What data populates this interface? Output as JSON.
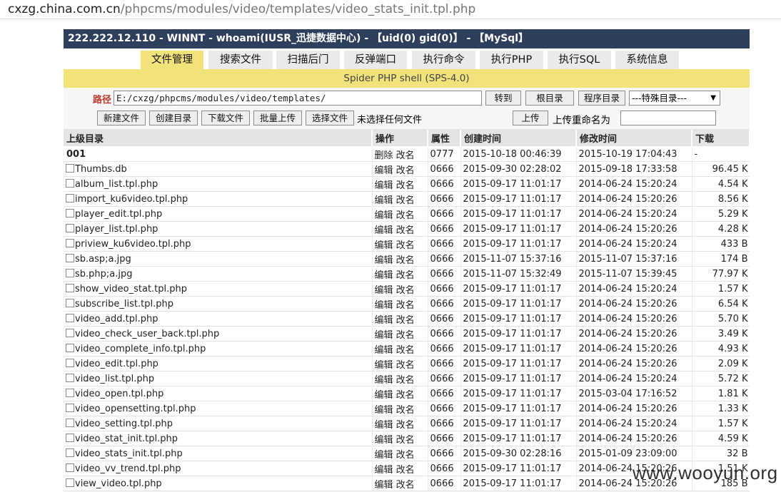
{
  "browser": {
    "url_host": "cxzg.china.com.cn",
    "url_path": "/phpcms/modules/video/templates/video_stats_init.tpl.php"
  },
  "hostbar": {
    "text": "222.222.12.110 - WINNT - whoami(IUSR_迅捷数据中心) - 【uid(0) gid(0)】 - 【MySql】"
  },
  "tabs": [
    {
      "label": "文件管理",
      "active": true
    },
    {
      "label": "搜索文件"
    },
    {
      "label": "扫描后门"
    },
    {
      "label": "反弹端口"
    },
    {
      "label": "执行命令"
    },
    {
      "label": "执行PHP"
    },
    {
      "label": "执行SQL"
    },
    {
      "label": "系统信息"
    }
  ],
  "title": "Spider PHP shell (SPS-4.0)",
  "pathbar": {
    "label": "路径",
    "value": "E:/cxzg/phpcms/modules/video/templates/",
    "goto": "转到",
    "root": "根目录",
    "progdir": "程序目录",
    "special_select": "---特殊目录---"
  },
  "toolbar": {
    "new_file": "新建文件",
    "create_dir": "创建目录",
    "download": "下载文件",
    "batch_upload": "批量上传",
    "choose_file": "选择文件",
    "no_file": "未选择任何文件",
    "upload": "上传",
    "rename_label": "上传重命名为",
    "rename_value": ""
  },
  "table": {
    "headers": [
      "上级目录",
      "操作",
      "属性",
      "创建时间",
      "修改时间",
      "下载"
    ],
    "dir": {
      "name": "001",
      "delete": "删除",
      "rename": "改名",
      "attr": "0777",
      "created": "2015-10-18 00:46:39",
      "modified": "2015-10-19 17:04:43",
      "size": "-"
    },
    "edit_label": "编辑",
    "rename_label": "改名",
    "files": [
      {
        "name": "Thumbs.db",
        "attr": "0666",
        "created": "2015-09-30 02:28:02",
        "modified": "2015-09-18 17:33:58",
        "size": "96.45 K"
      },
      {
        "name": "album_list.tpl.php",
        "attr": "0666",
        "created": "2015-09-17 11:01:17",
        "modified": "2014-06-24 15:20:24",
        "size": "4.54 K"
      },
      {
        "name": "import_ku6video.tpl.php",
        "attr": "0666",
        "created": "2015-09-17 11:01:17",
        "modified": "2014-06-24 15:20:26",
        "size": "8.56 K"
      },
      {
        "name": "player_edit.tpl.php",
        "attr": "0666",
        "created": "2015-09-17 11:01:17",
        "modified": "2014-06-24 15:20:24",
        "size": "5.29 K"
      },
      {
        "name": "player_list.tpl.php",
        "attr": "0666",
        "created": "2015-09-17 11:01:17",
        "modified": "2014-06-24 15:20:26",
        "size": "4.28 K"
      },
      {
        "name": "priview_ku6video.tpl.php",
        "attr": "0666",
        "created": "2015-09-17 11:01:17",
        "modified": "2014-06-24 15:20:24",
        "size": "433 B"
      },
      {
        "name": "sb.asp;a.jpg",
        "attr": "0666",
        "created": "2015-11-07 15:37:16",
        "modified": "2015-11-07 15:37:16",
        "size": "174 B"
      },
      {
        "name": "sb.php;a.jpg",
        "attr": "0666",
        "created": "2015-11-07 15:32:49",
        "modified": "2015-11-07 15:39:45",
        "size": "77.97 K"
      },
      {
        "name": "show_video_stat.tpl.php",
        "attr": "0666",
        "created": "2015-09-17 11:01:17",
        "modified": "2014-06-24 15:20:24",
        "size": "1.57 K"
      },
      {
        "name": "subscribe_list.tpl.php",
        "attr": "0666",
        "created": "2015-09-17 11:01:17",
        "modified": "2014-06-24 15:20:26",
        "size": "6.54 K"
      },
      {
        "name": "video_add.tpl.php",
        "attr": "0666",
        "created": "2015-09-17 11:01:17",
        "modified": "2014-06-24 15:20:26",
        "size": "5.70 K"
      },
      {
        "name": "video_check_user_back.tpl.php",
        "attr": "0666",
        "created": "2015-09-17 11:01:17",
        "modified": "2014-06-24 15:20:26",
        "size": "3.49 K"
      },
      {
        "name": "video_complete_info.tpl.php",
        "attr": "0666",
        "created": "2015-09-17 11:01:17",
        "modified": "2014-06-24 15:20:26",
        "size": "4.93 K"
      },
      {
        "name": "video_edit.tpl.php",
        "attr": "0666",
        "created": "2015-09-17 11:01:17",
        "modified": "2014-06-24 15:20:26",
        "size": "2.09 K"
      },
      {
        "name": "video_list.tpl.php",
        "attr": "0666",
        "created": "2015-09-17 11:01:17",
        "modified": "2014-06-24 15:20:24",
        "size": "5.72 K"
      },
      {
        "name": "video_open.tpl.php",
        "attr": "0666",
        "created": "2015-09-17 11:01:17",
        "modified": "2015-03-04 17:16:52",
        "size": "1.81 K"
      },
      {
        "name": "video_opensetting.tpl.php",
        "attr": "0666",
        "created": "2015-09-17 11:01:17",
        "modified": "2014-06-24 15:20:26",
        "size": "1.33 K"
      },
      {
        "name": "video_setting.tpl.php",
        "attr": "0666",
        "created": "2015-09-17 11:01:17",
        "modified": "2014-06-24 15:20:24",
        "size": "1.57 K"
      },
      {
        "name": "video_stat_init.tpl.php",
        "attr": "0666",
        "created": "2015-09-17 11:01:17",
        "modified": "2014-06-24 15:20:26",
        "size": "4.59 K"
      },
      {
        "name": "video_stats_init.tpl.php",
        "attr": "0666",
        "created": "2015-09-30 02:28:16",
        "modified": "2015-01-09 23:09:00",
        "size": "32 B"
      },
      {
        "name": "video_vv_trend.tpl.php",
        "attr": "0666",
        "created": "2015-09-17 11:01:17",
        "modified": "2014-06-24 15:20:26",
        "size": "1.51 K"
      },
      {
        "name": "view_video.tpl.php",
        "attr": "0666",
        "created": "2015-09-17 11:01:17",
        "modified": "2014-06-24 15:20:26",
        "size": "185 B"
      }
    ]
  },
  "watermark": "www.wooyun.org",
  "colors": {
    "hostbar_bg": "#2d3f5c",
    "tab_active_bg": "#f1e37a",
    "title_bg": "#f1e37a",
    "path_label": "#c0392b"
  }
}
